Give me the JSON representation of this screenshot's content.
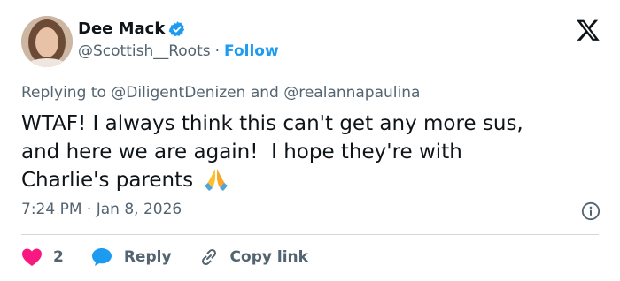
{
  "author": {
    "name": "Dee Mack",
    "handle": "@Scottish__Roots",
    "separator": "·",
    "follow_label": "Follow"
  },
  "icons": {
    "verified": "verified-badge-icon",
    "x_logo": "x-logo-icon",
    "info": "info-icon",
    "heart": "heart-icon",
    "reply": "reply-bubble-icon",
    "link": "link-icon",
    "emoji": "folded-hands-emoji"
  },
  "reply_context": {
    "prefix": "Replying to",
    "mention1": "@DiligentDenizen",
    "conjunction": "and",
    "mention2": "@realannapaulina"
  },
  "tweet": {
    "text": "WTAF! I always think this can't get any more sus,\nand here we are again!  I hope they're with\nCharlie's parents "
  },
  "meta": {
    "time": "7:24 PM",
    "separator": "·",
    "date": "Jan 8, 2026"
  },
  "actions": {
    "like_count": "2",
    "reply_label": "Reply",
    "copy_link_label": "Copy link"
  },
  "colors": {
    "accent": "#1d9bf0",
    "heart": "#f91880",
    "text": "#0f1419",
    "secondary": "#536471"
  }
}
